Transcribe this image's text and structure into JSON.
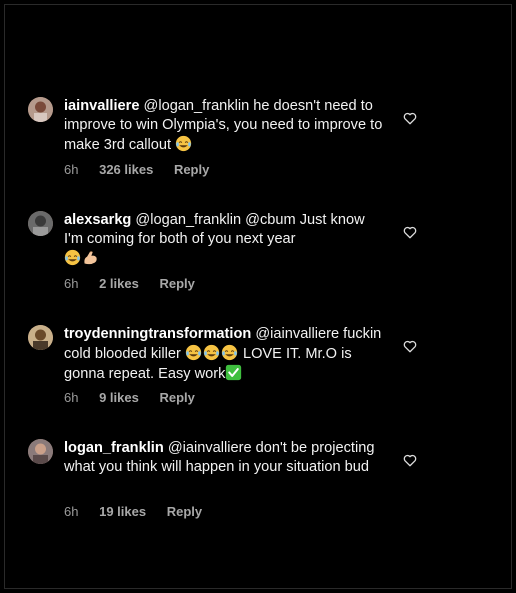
{
  "comments": [
    {
      "username": "iainvalliere",
      "text": "@logan_franklin he doesn't need to improve to win Olympia's, you need to improve to make 3rd callout",
      "emojis_after": [
        "laughing-tears"
      ],
      "time": "6h",
      "likes": "326 likes",
      "reply": "Reply"
    },
    {
      "username": "alexsarkg",
      "text": "@logan_franklin @cbum Just know I'm coming for both of you next year",
      "emojis_after": [
        "laughing-tears",
        "flexed-biceps"
      ],
      "time": "6h",
      "likes": "2 likes",
      "reply": "Reply"
    },
    {
      "username": "troydenningtransformation",
      "text_before": "@iainvalliere fuckin cold blooded killer",
      "text_after": " LOVE IT. Mr.O is gonna repeat. Easy work",
      "time": "6h",
      "likes": "9 likes",
      "reply": "Reply"
    },
    {
      "username": "logan_franklin",
      "text": "@iainvalliere don't be projecting what you think will happen in your situation bud",
      "time": "6h",
      "likes": "19 likes",
      "reply": "Reply"
    }
  ],
  "colors": {
    "background": "#000000",
    "text": "#f2f2f2",
    "meta": "#9a9a9a",
    "check_emoji": "#3fbf3f",
    "laugh_emoji": "#f6c343"
  },
  "icons": [
    "heart-outline-icon",
    "laughing-tears-emoji",
    "flexed-biceps-emoji",
    "check-mark-emoji"
  ]
}
